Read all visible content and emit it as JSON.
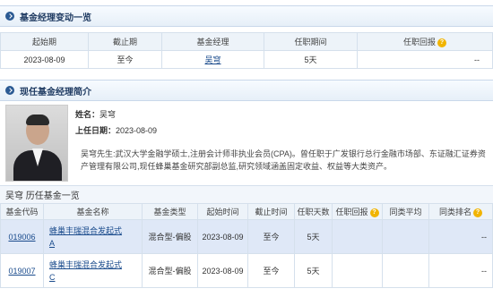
{
  "change_section": {
    "title": "基金经理变动一览",
    "columns": [
      "起始期",
      "截止期",
      "基金经理",
      "任职期间",
      "任职回报"
    ],
    "rows": [
      {
        "start": "2023-08-09",
        "end": "至今",
        "manager": "吴穹",
        "period": "5天",
        "return": "--"
      }
    ]
  },
  "current_section": {
    "title": "现任基金经理简介",
    "name_label": "姓名：",
    "name_value": "吴穹",
    "start_label": "上任日期：",
    "start_value": "2023-08-09",
    "bio": "吴穹先生:武汉大学金融学硕士,注册会计师非执业会员(CPA)。曾任职于广发银行总行金融市场部、东证融汇证券资产管理有限公司,现任蜂巢基金研究部副总监,研究领域涵盖固定收益、权益等大类资产。"
  },
  "history_section": {
    "title": "吴穹 历任基金一览",
    "columns": [
      "基金代码",
      "基金名称",
      "基金类型",
      "起始时间",
      "截止时间",
      "任职天数",
      "任职回报",
      "同类平均",
      "同类排名"
    ],
    "rows": [
      {
        "code": "019006",
        "name_line1": "蜂巢丰瑞混合发起式",
        "name_line2": "A",
        "type": "混合型-偏股",
        "start": "2023-08-09",
        "end": "至今",
        "days": "5天",
        "ret": "",
        "avg": "",
        "rank": "--"
      },
      {
        "code": "019007",
        "name_line1": "蜂巢丰瑞混合发起式",
        "name_line2": "C",
        "type": "混合型-偏股",
        "start": "2023-08-09",
        "end": "至今",
        "days": "5天",
        "ret": "",
        "avg": "",
        "rank": "--"
      }
    ]
  },
  "icons": {
    "help": "?"
  }
}
